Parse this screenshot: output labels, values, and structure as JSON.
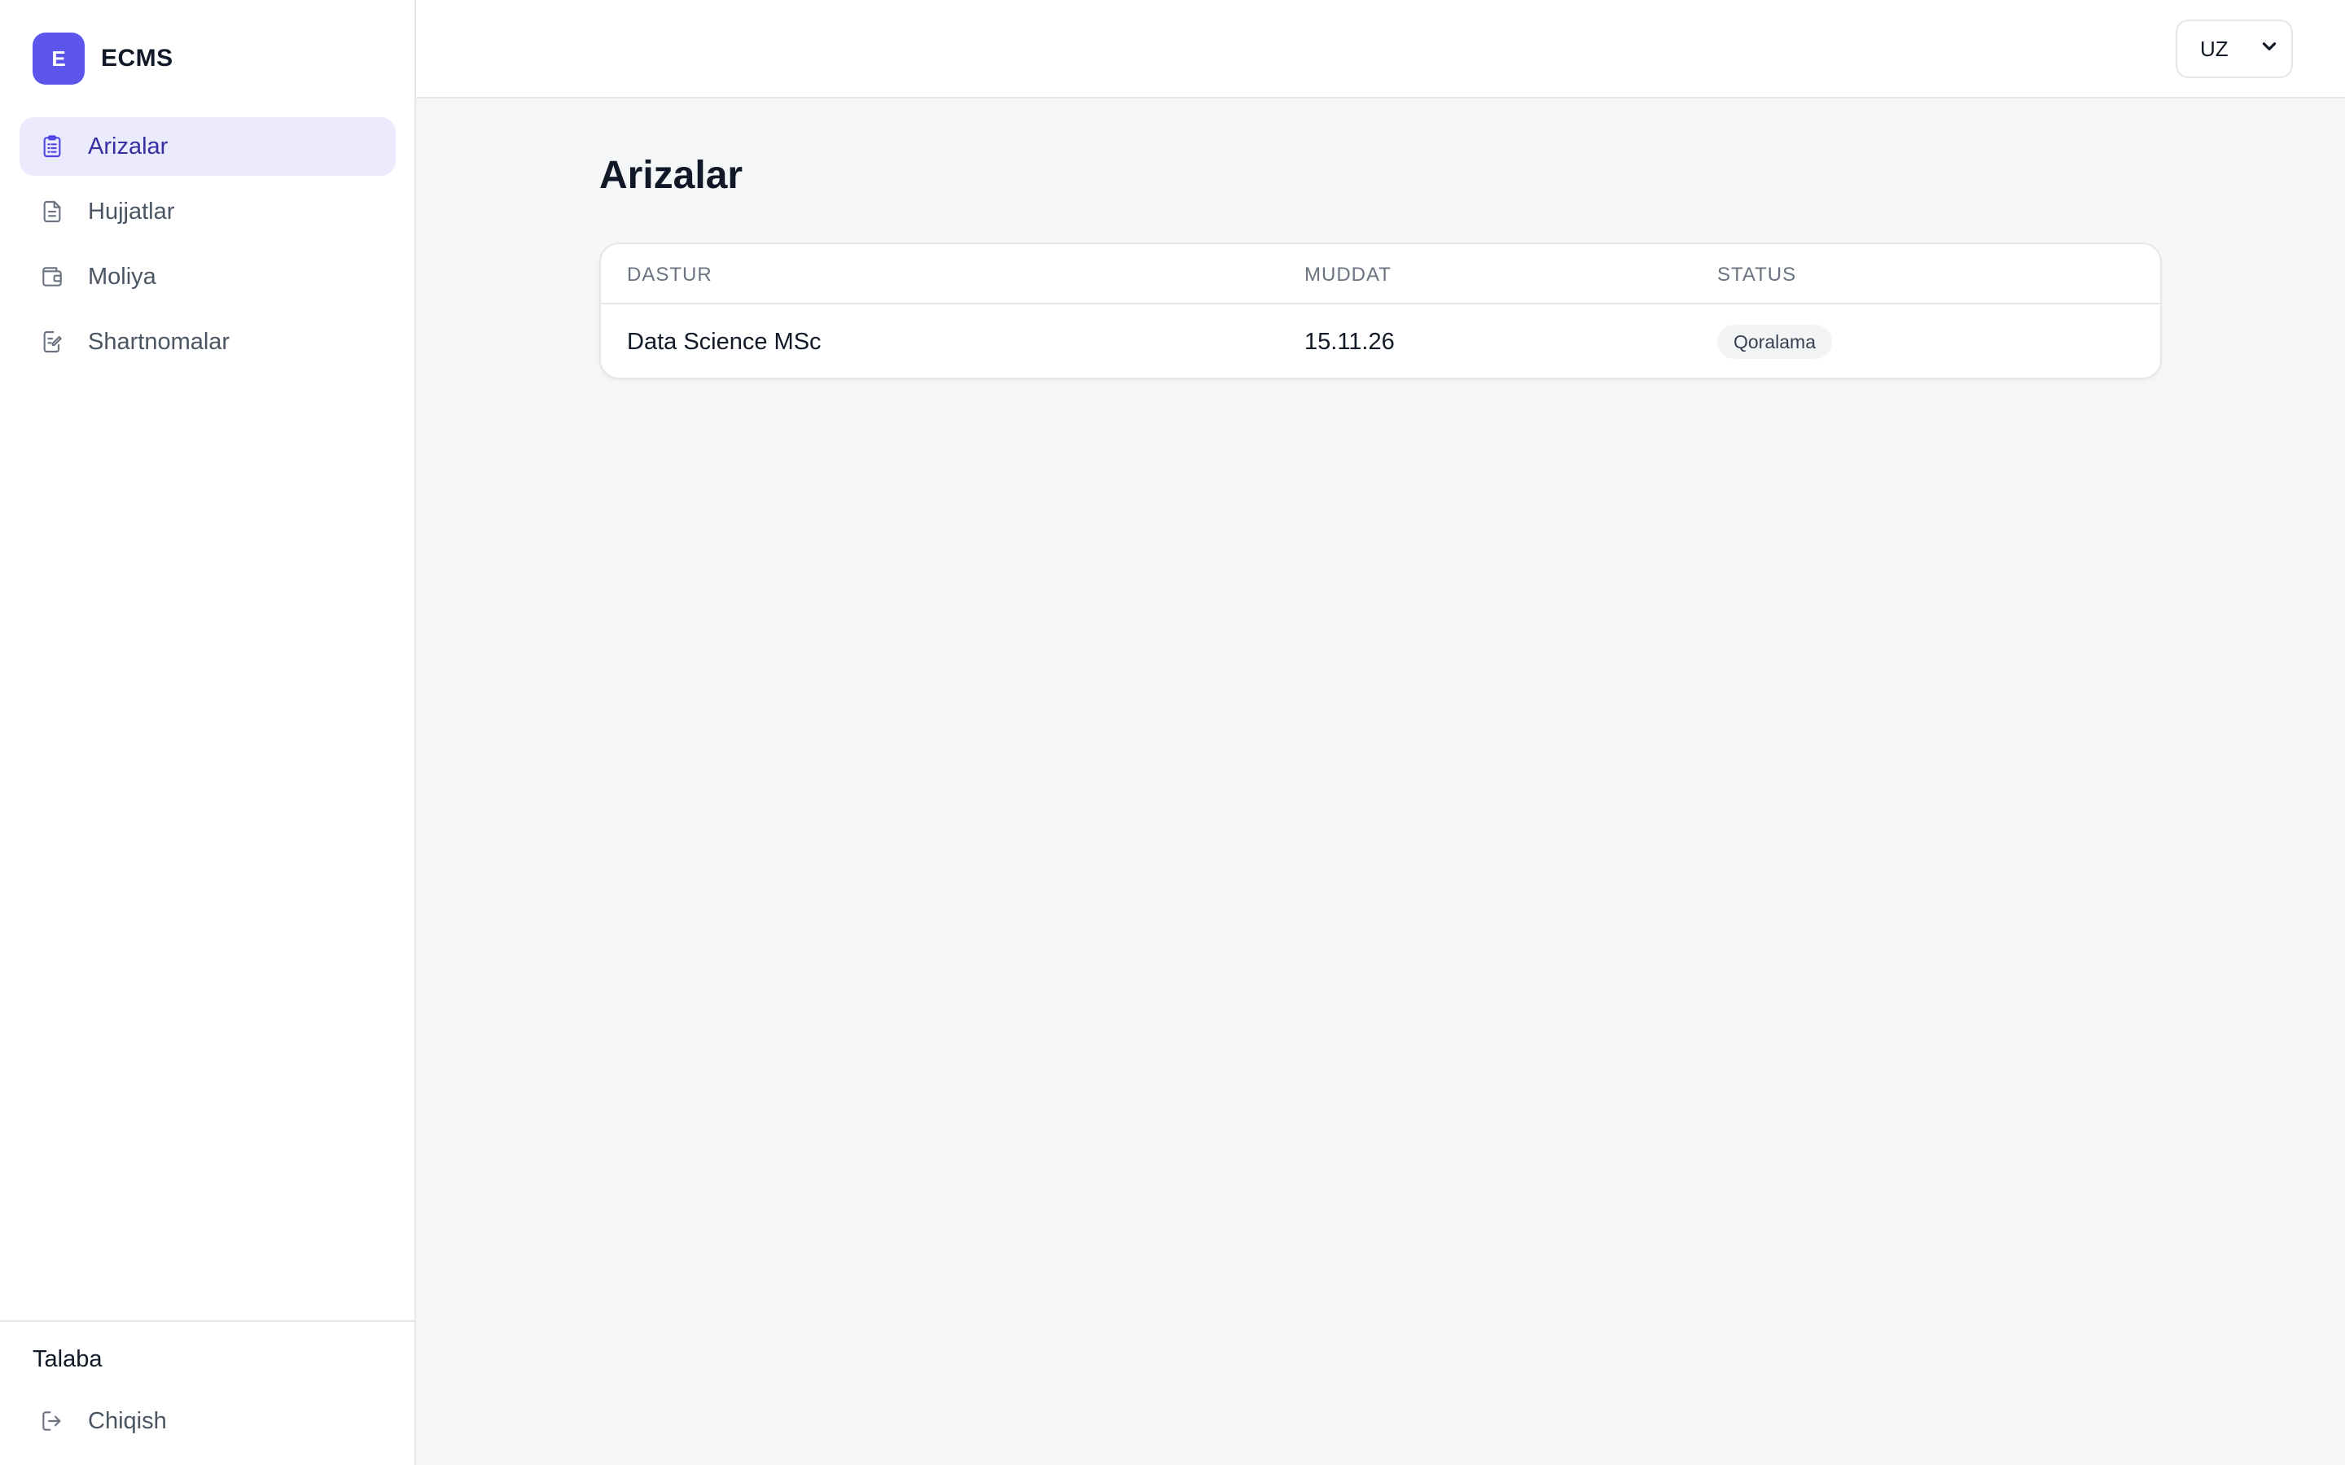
{
  "brand": {
    "logo_letter": "E",
    "name": "ECMS",
    "accent": "#5b55ec"
  },
  "sidebar": {
    "items": [
      {
        "label": "Arizalar",
        "icon": "clipboard-icon",
        "active": true
      },
      {
        "label": "Hujjatlar",
        "icon": "document-icon",
        "active": false
      },
      {
        "label": "Moliya",
        "icon": "wallet-icon",
        "active": false
      },
      {
        "label": "Shartnomalar",
        "icon": "edit-document-icon",
        "active": false
      }
    ],
    "role": "Talaba",
    "logout_label": "Chiqish",
    "logout_icon": "logout-icon"
  },
  "header": {
    "language": {
      "selected": "UZ",
      "icon": "chevron-down-icon"
    }
  },
  "main": {
    "title": "Arizalar",
    "table": {
      "columns": [
        "DASTUR",
        "MUDDAT",
        "STATUS"
      ],
      "rows": [
        {
          "program": "Data Science MSc",
          "deadline": "15.11.26",
          "status": "Qoralama"
        }
      ]
    }
  }
}
